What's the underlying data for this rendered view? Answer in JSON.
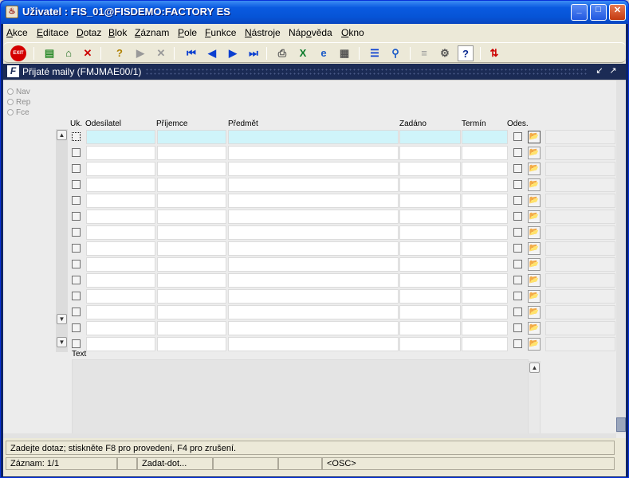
{
  "window": {
    "title": "Uživatel : FIS_01@FISDEMO:FACTORY ES"
  },
  "menu": [
    {
      "u": "A",
      "rest": "kce"
    },
    {
      "u": "E",
      "rest": "ditace"
    },
    {
      "u": "D",
      "rest": "otaz"
    },
    {
      "u": "B",
      "rest": "lok"
    },
    {
      "u": "Z",
      "rest": "áznam"
    },
    {
      "u": "P",
      "rest": "ole"
    },
    {
      "u": "F",
      "rest": "unkce"
    },
    {
      "u": "N",
      "rest": "ástroje"
    },
    {
      "pre": "Náp",
      "u": "o",
      "rest": "věda"
    },
    {
      "u": "O",
      "rest": "kno"
    }
  ],
  "toolbar": {
    "exit_label": "EXIT",
    "icons": [
      "insert-record-icon",
      "save-icon",
      "delete-record-icon",
      "enter-query-icon",
      "execute-query-icon",
      "cancel-query-icon",
      "first-record-icon",
      "previous-record-icon",
      "next-record-icon",
      "last-record-icon",
      "print-icon",
      "excel-icon",
      "browser-icon",
      "export-icon",
      "list-icon",
      "search-icon",
      "edit-icon",
      "settings-icon",
      "help-icon",
      "sort-icon"
    ]
  },
  "form": {
    "title": "Přijaté maily (FMJMAE00/1)",
    "radios": [
      "Nav",
      "Rep",
      "Fce"
    ],
    "columns": {
      "uk": "Uk.",
      "sender": "Odesílatel",
      "recipient": "Příjemce",
      "subject": "Předmět",
      "assigned": "Zadáno",
      "deadline": "Termín",
      "sent": "Odes."
    },
    "row_count": 14,
    "text_label": "Text"
  },
  "status": {
    "message": "Zadejte dotaz; stiskněte F8 pro provedení, F4 pro zrušení.",
    "record": "Záznam: 1/1",
    "mode": "Zadat-dot...",
    "osc": "<OSC>"
  },
  "colors": {
    "current_row": "#cff4fa",
    "title_blue": "#0a5ae0",
    "form_bar": "#1b2b55"
  }
}
